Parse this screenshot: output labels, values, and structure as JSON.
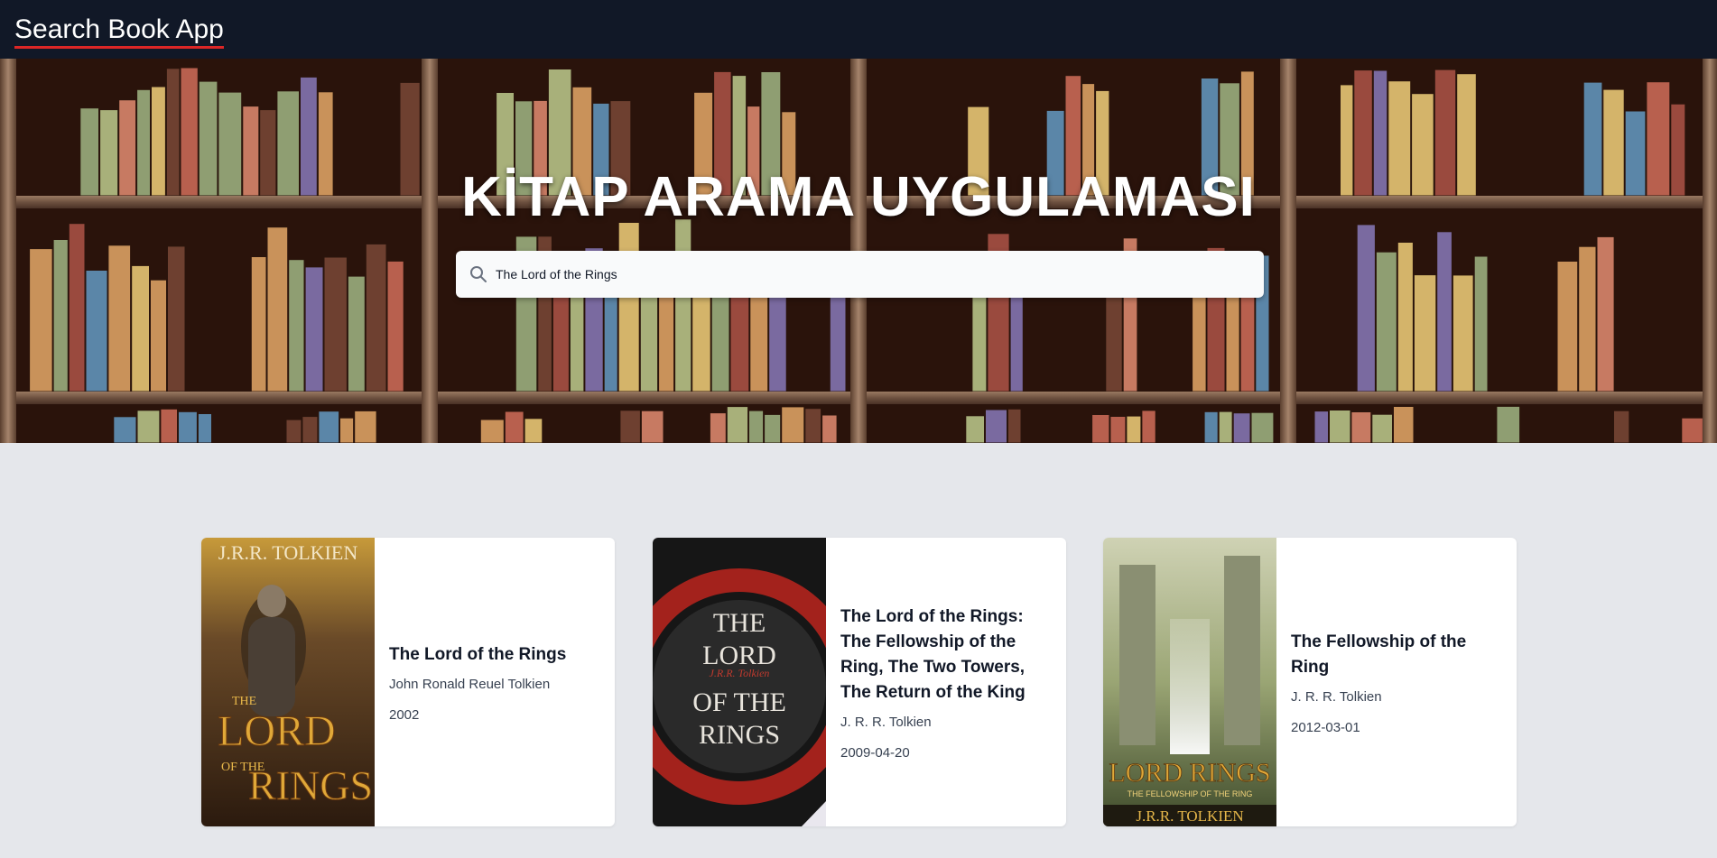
{
  "header": {
    "app_title": "Search Book App"
  },
  "hero": {
    "title": "KİTAP ARAMA UYGULAMASI",
    "search": {
      "value": "The Lord of the Rings",
      "placeholder": ""
    }
  },
  "results": [
    {
      "title": "The Lord of the Rings",
      "author": "John Ronald Reuel Tolkien",
      "date": "2002",
      "cover_text": {
        "top": "J.R.R. TOLKIEN",
        "logo": [
          "THE",
          "LORD",
          "OF THE",
          "RINGS"
        ]
      }
    },
    {
      "title": "The Lord of the Rings: The Fellowship of the Ring, The Two Towers, The Return of the King",
      "author": "J. R. R. Tolkien",
      "date": "2009-04-20",
      "cover_text": {
        "lines": [
          "THE",
          "LORD",
          "OF THE",
          "RINGS"
        ],
        "signature": "J.R.R. Tolkien"
      }
    },
    {
      "title": "The Fellowship of the Ring",
      "author": "J. R. R. Tolkien",
      "date": "2012-03-01",
      "cover_text": {
        "logo": [
          "LORD",
          "RINGS"
        ],
        "subtitle": "THE FELLOWSHIP OF THE RING",
        "author": "J.R.R. TOLKIEN"
      }
    }
  ],
  "colors": {
    "header_bg": "#111827",
    "underline": "#dc2626",
    "page_bg": "#e5e7eb"
  }
}
